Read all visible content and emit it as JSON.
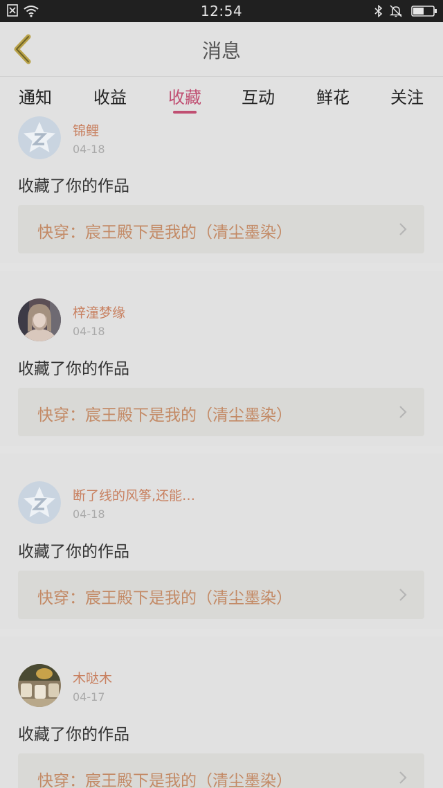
{
  "status_bar": {
    "time": "12:54"
  },
  "header": {
    "title": "消息"
  },
  "tabs": [
    {
      "label": "通知"
    },
    {
      "label": "收益"
    },
    {
      "label": "收藏"
    },
    {
      "label": "互动"
    },
    {
      "label": "鲜花"
    },
    {
      "label": "关注"
    }
  ],
  "active_tab": "收藏",
  "colors": {
    "accent": "#c04f72",
    "username": "#c88060",
    "work_title": "#c38a66"
  },
  "messages": [
    {
      "username": "锦鲤",
      "date": "04-18",
      "action": "收藏了你的作品",
      "work": "快穿：宸王殿下是我的（清尘墨染）",
      "avatar": "default-avatar-icon"
    },
    {
      "username": "梓潼梦缘",
      "date": "04-18",
      "action": "收藏了你的作品",
      "work": "快穿：宸王殿下是我的（清尘墨染）",
      "avatar": "user-photo"
    },
    {
      "username": "断了线的风筝,还能…",
      "date": "04-18",
      "action": "收藏了你的作品",
      "work": "快穿：宸王殿下是我的（清尘墨染）",
      "avatar": "default-avatar-icon"
    },
    {
      "username": "木哒木",
      "date": "04-17",
      "action": "收藏了你的作品",
      "work": "快穿：宸王殿下是我的（清尘墨染）",
      "avatar": "user-photo"
    }
  ]
}
